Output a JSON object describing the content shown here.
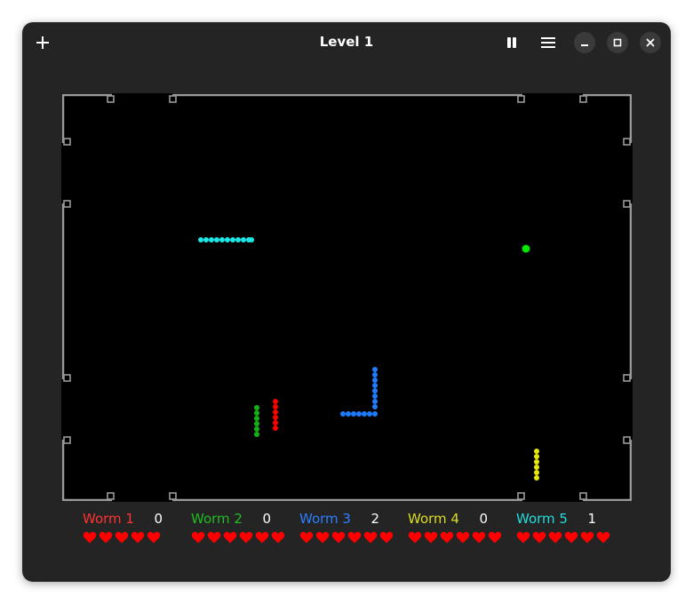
{
  "window": {
    "title": "Level 1",
    "icons": {
      "new_game": "plus-icon",
      "pause": "pause-icon",
      "menu": "hamburger-menu-icon",
      "minimize": "minimize-icon",
      "maximize": "maximize-icon",
      "close": "close-icon"
    }
  },
  "colors": {
    "worm1": "#ff0000",
    "worm2": "#13b113",
    "worm3": "#1e7dff",
    "worm4": "#e6e60a",
    "worm5": "#1fe6e6",
    "heart": "#ff0000",
    "food": "#00e600",
    "wall": "#9a9a9a"
  },
  "worms": [
    {
      "name": "Worm 1",
      "score": "0",
      "lives": 5,
      "color": "#ff3333"
    },
    {
      "name": "Worm 2",
      "score": "0",
      "lives": 6,
      "color": "#22bb22"
    },
    {
      "name": "Worm 3",
      "score": "2",
      "lives": 6,
      "color": "#2b7fff"
    },
    {
      "name": "Worm 4",
      "score": "0",
      "lives": 6,
      "color": "#dddd22"
    },
    {
      "name": "Worm 5",
      "score": "1",
      "lives": 6,
      "color": "#22dddd"
    }
  ]
}
